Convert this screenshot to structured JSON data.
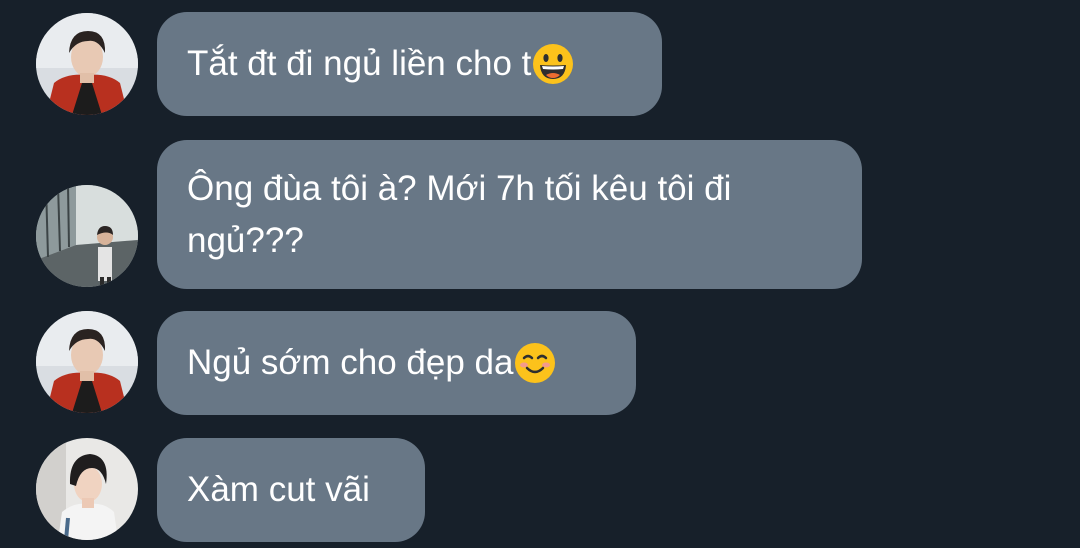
{
  "messages": [
    {
      "text": "Tắt đt đi ngủ liền cho t",
      "emoji": "grinning-face-icon",
      "sender": "user-a"
    },
    {
      "text": "Ông đùa tôi à? Mới 7h tối kêu tôi đi ngủ???",
      "emoji": null,
      "sender": "user-b"
    },
    {
      "text": "Ngủ sớm cho đẹp da",
      "emoji": "smiling-face-icon",
      "sender": "user-a"
    },
    {
      "text": "Xàm cut vãi",
      "emoji": null,
      "sender": "user-c"
    }
  ],
  "colors": {
    "background": "#17202a",
    "bubble": "#687786",
    "text": "#ffffff"
  }
}
